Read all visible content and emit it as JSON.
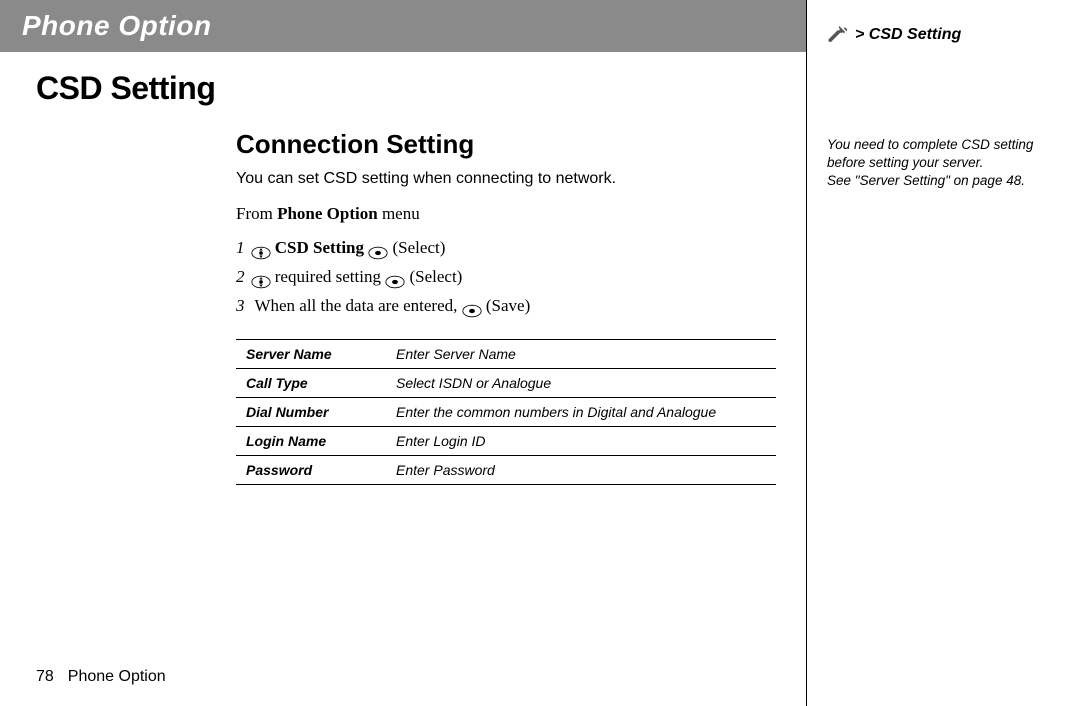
{
  "header": {
    "title": "Phone Option"
  },
  "breadcrumb": {
    "label": "> CSD Setting"
  },
  "page": {
    "title": "CSD Setting",
    "subtitle": "Connection Setting",
    "intro": "You can set CSD setting when connecting to network.",
    "from_prefix": "From ",
    "from_bold": "Phone Option",
    "from_suffix": " menu"
  },
  "steps": [
    {
      "num": "1",
      "parts": [
        {
          "icon": "nav"
        },
        {
          "bold": true,
          "text": " CSD Setting "
        },
        {
          "icon": "select"
        },
        {
          "text": " (Select)"
        }
      ]
    },
    {
      "num": "2",
      "parts": [
        {
          "icon": "nav"
        },
        {
          "text": " required setting "
        },
        {
          "icon": "select"
        },
        {
          "text": " (Select)"
        }
      ]
    },
    {
      "num": "3",
      "parts": [
        {
          "text": " When all the data are entered, "
        },
        {
          "icon": "select"
        },
        {
          "text": " (Save)"
        }
      ]
    }
  ],
  "table": [
    {
      "key": "Server Name",
      "value": "Enter Server Name"
    },
    {
      "key": "Call Type",
      "value": "Select ISDN or Analogue"
    },
    {
      "key": "Dial Number",
      "value": "Enter the common numbers in Digital and Analogue"
    },
    {
      "key": "Login Name",
      "value": "Enter Login ID"
    },
    {
      "key": "Password",
      "value": "Enter Password"
    }
  ],
  "sidenote": {
    "line1": "You need to complete CSD setting before setting your server.",
    "line2": "See \"Server Setting\" on page 48."
  },
  "footer": {
    "page_number": "78",
    "section": "Phone Option"
  }
}
